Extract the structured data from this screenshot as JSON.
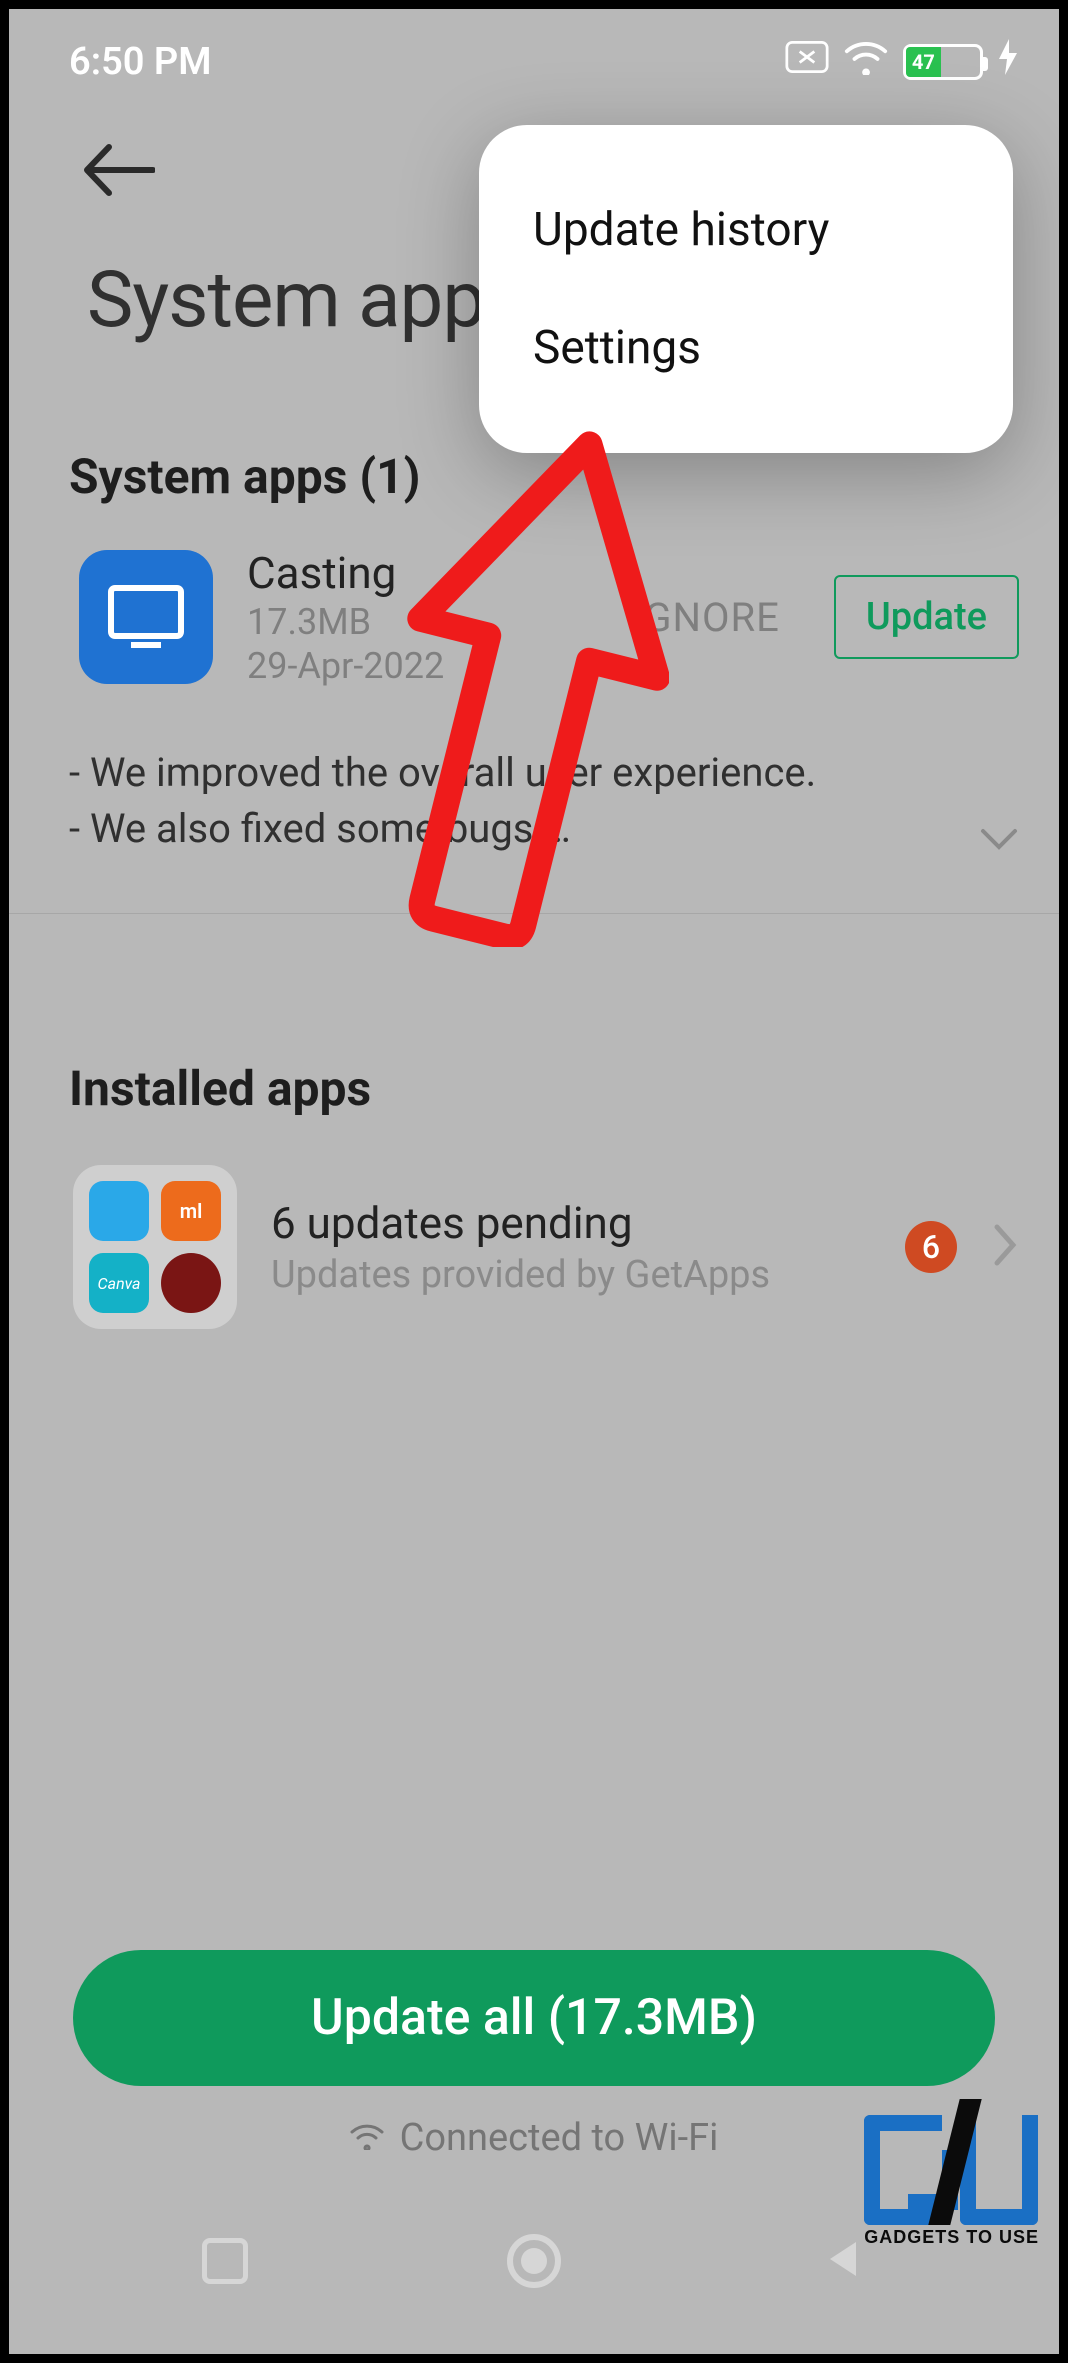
{
  "status": {
    "time": "6:50 PM",
    "battery_pct": "47"
  },
  "header": {
    "title": "System app upd"
  },
  "popup": {
    "items": [
      "Update history",
      "Settings"
    ]
  },
  "system_apps": {
    "heading": "System apps (1)",
    "app": {
      "name": "Casting",
      "size": "17.3MB",
      "date": "29-Apr-2022",
      "ignore_label": "IGNORE",
      "update_label": "Update",
      "changelog_line1": "- We improved the overall user experience.",
      "changelog_line2": "- We also fixed some bugs.…"
    }
  },
  "installed": {
    "heading": "Installed apps",
    "pending": {
      "title": "6 updates pending",
      "subtitle": "Updates provided by GetApps",
      "badge": "6"
    }
  },
  "footer": {
    "update_all_label": "Update all (17.3MB)",
    "wifi_label": "Connected to Wi-Fi"
  },
  "watermark": {
    "text": "GADGETS TO USE"
  }
}
